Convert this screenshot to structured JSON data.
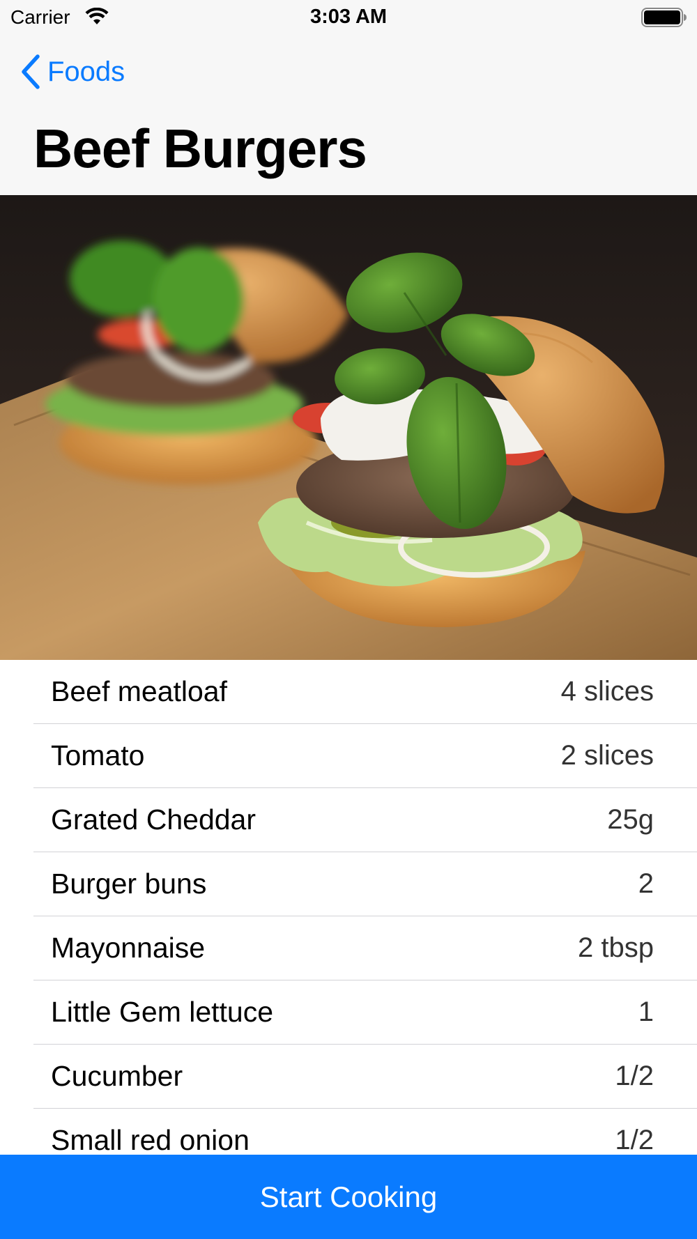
{
  "status_bar": {
    "carrier": "Carrier",
    "time": "3:03 AM",
    "wifi_icon": "wifi-icon",
    "battery_icon": "battery-icon"
  },
  "nav": {
    "back_label": "Foods",
    "back_icon": "chevron-left-icon",
    "title": "Beef Burgers"
  },
  "hero": {
    "image": "burger-photo"
  },
  "ingredients": [
    {
      "name": "Beef meatloaf",
      "quantity": "4 slices"
    },
    {
      "name": "Tomato",
      "quantity": "2 slices"
    },
    {
      "name": "Grated Cheddar",
      "quantity": "25g"
    },
    {
      "name": "Burger buns",
      "quantity": "2"
    },
    {
      "name": "Mayonnaise",
      "quantity": "2 tbsp"
    },
    {
      "name": "Little Gem lettuce",
      "quantity": "1"
    },
    {
      "name": "Cucumber",
      "quantity": "1/2"
    },
    {
      "name": "Small red onion",
      "quantity": "1/2"
    }
  ],
  "actions": {
    "start_label": "Start Cooking"
  },
  "colors": {
    "accent": "#0a7bff",
    "nav_background": "#f7f7f7",
    "separator": "#d2d2d6"
  }
}
